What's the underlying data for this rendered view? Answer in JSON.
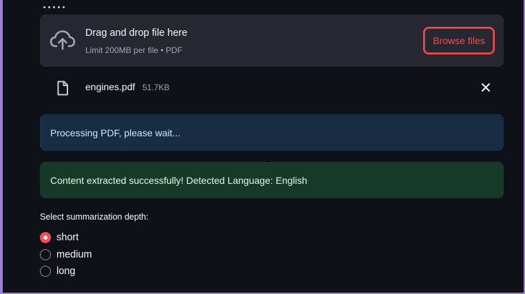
{
  "uploader": {
    "title": "Drag and drop file here",
    "subtitle": "Limit 200MB per file • PDF",
    "browse_label": "Browse files",
    "upload_icon": "cloud-upload-icon"
  },
  "file": {
    "name": "engines.pdf",
    "size": "51.7KB",
    "file_icon": "file-icon",
    "remove_icon": "close-icon"
  },
  "alerts": {
    "info": "Processing PDF, please wait...",
    "success": "Content extracted successfully! Detected Language: English"
  },
  "depth": {
    "label": "Select summarization depth:",
    "options": [
      "short",
      "medium",
      "long"
    ],
    "selected": "short"
  },
  "colors": {
    "background": "#0e1117",
    "surface": "#262730",
    "accent": "#ff4b4b",
    "info_bg": "#172d43",
    "success_bg": "#173928"
  }
}
